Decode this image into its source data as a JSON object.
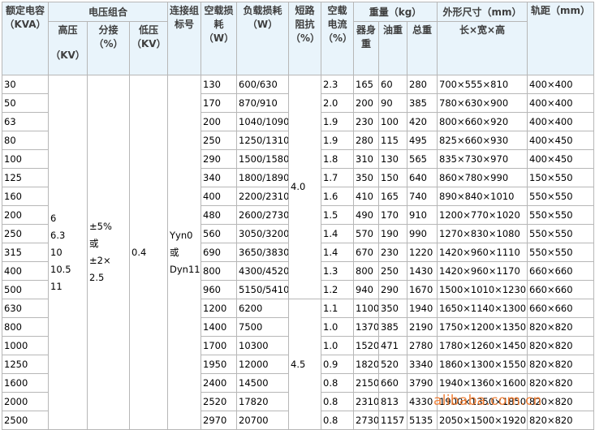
{
  "headers": {
    "rated_capacity": "额定电容（KVA）",
    "voltage_combo": "电压组合",
    "high_voltage": "高压",
    "high_voltage_unit": "（KV）",
    "tap": "分接（%）",
    "low_voltage": "低压（KV）",
    "connection_group": "连接组标号",
    "no_load_loss": "空载损耗（W）",
    "load_loss": "负载损耗（W）",
    "short_circuit_impedance": "短路阻抗（%）",
    "no_load_current": "空载电流（%）",
    "weight": "重量（kg）",
    "body_weight": "器身重",
    "oil_weight": "油重",
    "total_weight": "总重",
    "dimensions": "外形尺寸（mm）",
    "dimensions_sub": "长×宽×高",
    "track_gauge": "轨距（mm）"
  },
  "merged": {
    "high_voltage_values": [
      "6",
      "6.3",
      "10",
      "10.5",
      "11"
    ],
    "tap_values": [
      "±5%",
      "或",
      "±2×",
      "2.5"
    ],
    "low_voltage_value": "0.4",
    "connection_values": [
      "Yyn0",
      "或",
      "Dyn11"
    ],
    "impedance_group1": "4.0",
    "impedance_group2": "4.5"
  },
  "rows": [
    {
      "kva": "30",
      "no_load": "130",
      "load": "600/630",
      "current": "2.3",
      "body": "165",
      "oil": "60",
      "total": "280",
      "dims": "700×555×810",
      "track": "400×400"
    },
    {
      "kva": "50",
      "no_load": "170",
      "load": "870/910",
      "current": "2.0",
      "body": "200",
      "oil": "90",
      "total": "385",
      "dims": "780×630×900",
      "track": "400×400"
    },
    {
      "kva": "63",
      "no_load": "200",
      "load": "1040/1090",
      "current": "1.9",
      "body": "230",
      "oil": "100",
      "total": "420",
      "dims": "800×660×920",
      "track": "400×400"
    },
    {
      "kva": "80",
      "no_load": "250",
      "load": "1250/1310",
      "current": "1.9",
      "body": "280",
      "oil": "115",
      "total": "495",
      "dims": "825×660×930",
      "track": "400×450"
    },
    {
      "kva": "100",
      "no_load": "290",
      "load": "1500/1580",
      "current": "1.8",
      "body": "310",
      "oil": "130",
      "total": "565",
      "dims": "835×730×970",
      "track": "400×450"
    },
    {
      "kva": "125",
      "no_load": "340",
      "load": "1800/1890",
      "current": "1.7",
      "body": "350",
      "oil": "150",
      "total": "640",
      "dims": "860×780×990",
      "track": "150×550"
    },
    {
      "kva": "160",
      "no_load": "400",
      "load": "2200/2310",
      "current": "1.6",
      "body": "410",
      "oil": "165",
      "total": "740",
      "dims": "890×840×1010",
      "track": "550×550"
    },
    {
      "kva": "200",
      "no_load": "480",
      "load": "2600/2730",
      "current": "1.5",
      "body": "490",
      "oil": "170",
      "total": "910",
      "dims": "1200×770×1020",
      "track": "550×550"
    },
    {
      "kva": "250",
      "no_load": "560",
      "load": "3050/3200",
      "current": "1.4",
      "body": "570",
      "oil": "190",
      "total": "990",
      "dims": "1270×830×1080",
      "track": "550×550"
    },
    {
      "kva": "315",
      "no_load": "690",
      "load": "3650/3830",
      "current": "1.4",
      "body": "670",
      "oil": "230",
      "total": "1220",
      "dims": "1420×960×1110",
      "track": "550×550"
    },
    {
      "kva": "400",
      "no_load": "800",
      "load": "4300/4520",
      "current": "1.3",
      "body": "800",
      "oil": "250",
      "total": "1430",
      "dims": "1420×960×1170",
      "track": "660×660"
    },
    {
      "kva": "500",
      "no_load": "960",
      "load": "5150/5410",
      "current": "1.2",
      "body": "940",
      "oil": "290",
      "total": "1670",
      "dims": "1500×1010×1230",
      "track": "660×660"
    },
    {
      "kva": "630",
      "no_load": "1200",
      "load": "6200",
      "current": "1.1",
      "body": "1100",
      "oil": "350",
      "total": "1940",
      "dims": "1650×1140×1300",
      "track": "660×660"
    },
    {
      "kva": "800",
      "no_load": "1400",
      "load": "7500",
      "current": "1.0",
      "body": "1370",
      "oil": "385",
      "total": "2190",
      "dims": "1750×1200×1350",
      "track": "820×820"
    },
    {
      "kva": "1000",
      "no_load": "1700",
      "load": "10300",
      "current": "1.0",
      "body": "1520",
      "oil": "471",
      "total": "2780",
      "dims": "1780×1260×1450",
      "track": "820×820"
    },
    {
      "kva": "1250",
      "no_load": "1950",
      "load": "12000",
      "current": "0.9",
      "body": "1820",
      "oil": "520",
      "total": "3340",
      "dims": "1860×1300×1550",
      "track": "820×820"
    },
    {
      "kva": "1600",
      "no_load": "2400",
      "load": "14500",
      "current": "0.8",
      "body": "2150",
      "oil": "660",
      "total": "3790",
      "dims": "1940×1360×1600",
      "track": "820×820"
    },
    {
      "kva": "2000",
      "no_load": "2520",
      "load": "17820",
      "current": "0.8",
      "body": "2310",
      "oil": "813",
      "total": "4330",
      "dims": "1900×1350×1850",
      "track": "820×820"
    },
    {
      "kva": "2500",
      "no_load": "2970",
      "load": "20700",
      "current": "0.8",
      "body": "2730",
      "oil": "1157",
      "total": "5135",
      "dims": "2050×1500×1920",
      "track": "820×820"
    }
  ],
  "watermark": "alibaba.com.cn"
}
